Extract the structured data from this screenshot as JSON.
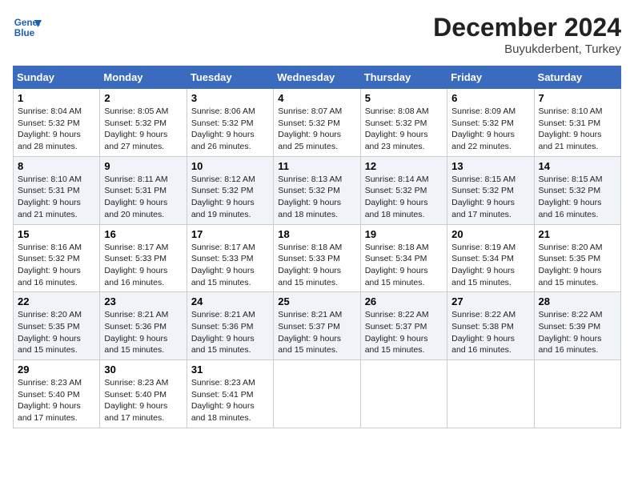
{
  "header": {
    "logo_line1": "General",
    "logo_line2": "Blue",
    "month_year": "December 2024",
    "location": "Buyukderbent, Turkey"
  },
  "days_of_week": [
    "Sunday",
    "Monday",
    "Tuesday",
    "Wednesday",
    "Thursday",
    "Friday",
    "Saturday"
  ],
  "weeks": [
    [
      {
        "day": "1",
        "sunrise": "8:04 AM",
        "sunset": "5:32 PM",
        "daylight": "9 hours and 28 minutes."
      },
      {
        "day": "2",
        "sunrise": "8:05 AM",
        "sunset": "5:32 PM",
        "daylight": "9 hours and 27 minutes."
      },
      {
        "day": "3",
        "sunrise": "8:06 AM",
        "sunset": "5:32 PM",
        "daylight": "9 hours and 26 minutes."
      },
      {
        "day": "4",
        "sunrise": "8:07 AM",
        "sunset": "5:32 PM",
        "daylight": "9 hours and 25 minutes."
      },
      {
        "day": "5",
        "sunrise": "8:08 AM",
        "sunset": "5:32 PM",
        "daylight": "9 hours and 23 minutes."
      },
      {
        "day": "6",
        "sunrise": "8:09 AM",
        "sunset": "5:32 PM",
        "daylight": "9 hours and 22 minutes."
      },
      {
        "day": "7",
        "sunrise": "8:10 AM",
        "sunset": "5:31 PM",
        "daylight": "9 hours and 21 minutes."
      }
    ],
    [
      {
        "day": "8",
        "sunrise": "8:10 AM",
        "sunset": "5:31 PM",
        "daylight": "9 hours and 21 minutes."
      },
      {
        "day": "9",
        "sunrise": "8:11 AM",
        "sunset": "5:31 PM",
        "daylight": "9 hours and 20 minutes."
      },
      {
        "day": "10",
        "sunrise": "8:12 AM",
        "sunset": "5:32 PM",
        "daylight": "9 hours and 19 minutes."
      },
      {
        "day": "11",
        "sunrise": "8:13 AM",
        "sunset": "5:32 PM",
        "daylight": "9 hours and 18 minutes."
      },
      {
        "day": "12",
        "sunrise": "8:14 AM",
        "sunset": "5:32 PM",
        "daylight": "9 hours and 18 minutes."
      },
      {
        "day": "13",
        "sunrise": "8:15 AM",
        "sunset": "5:32 PM",
        "daylight": "9 hours and 17 minutes."
      },
      {
        "day": "14",
        "sunrise": "8:15 AM",
        "sunset": "5:32 PM",
        "daylight": "9 hours and 16 minutes."
      }
    ],
    [
      {
        "day": "15",
        "sunrise": "8:16 AM",
        "sunset": "5:32 PM",
        "daylight": "9 hours and 16 minutes."
      },
      {
        "day": "16",
        "sunrise": "8:17 AM",
        "sunset": "5:33 PM",
        "daylight": "9 hours and 16 minutes."
      },
      {
        "day": "17",
        "sunrise": "8:17 AM",
        "sunset": "5:33 PM",
        "daylight": "9 hours and 15 minutes."
      },
      {
        "day": "18",
        "sunrise": "8:18 AM",
        "sunset": "5:33 PM",
        "daylight": "9 hours and 15 minutes."
      },
      {
        "day": "19",
        "sunrise": "8:18 AM",
        "sunset": "5:34 PM",
        "daylight": "9 hours and 15 minutes."
      },
      {
        "day": "20",
        "sunrise": "8:19 AM",
        "sunset": "5:34 PM",
        "daylight": "9 hours and 15 minutes."
      },
      {
        "day": "21",
        "sunrise": "8:20 AM",
        "sunset": "5:35 PM",
        "daylight": "9 hours and 15 minutes."
      }
    ],
    [
      {
        "day": "22",
        "sunrise": "8:20 AM",
        "sunset": "5:35 PM",
        "daylight": "9 hours and 15 minutes."
      },
      {
        "day": "23",
        "sunrise": "8:21 AM",
        "sunset": "5:36 PM",
        "daylight": "9 hours and 15 minutes."
      },
      {
        "day": "24",
        "sunrise": "8:21 AM",
        "sunset": "5:36 PM",
        "daylight": "9 hours and 15 minutes."
      },
      {
        "day": "25",
        "sunrise": "8:21 AM",
        "sunset": "5:37 PM",
        "daylight": "9 hours and 15 minutes."
      },
      {
        "day": "26",
        "sunrise": "8:22 AM",
        "sunset": "5:37 PM",
        "daylight": "9 hours and 15 minutes."
      },
      {
        "day": "27",
        "sunrise": "8:22 AM",
        "sunset": "5:38 PM",
        "daylight": "9 hours and 16 minutes."
      },
      {
        "day": "28",
        "sunrise": "8:22 AM",
        "sunset": "5:39 PM",
        "daylight": "9 hours and 16 minutes."
      }
    ],
    [
      {
        "day": "29",
        "sunrise": "8:23 AM",
        "sunset": "5:40 PM",
        "daylight": "9 hours and 17 minutes."
      },
      {
        "day": "30",
        "sunrise": "8:23 AM",
        "sunset": "5:40 PM",
        "daylight": "9 hours and 17 minutes."
      },
      {
        "day": "31",
        "sunrise": "8:23 AM",
        "sunset": "5:41 PM",
        "daylight": "9 hours and 18 minutes."
      },
      null,
      null,
      null,
      null
    ]
  ]
}
